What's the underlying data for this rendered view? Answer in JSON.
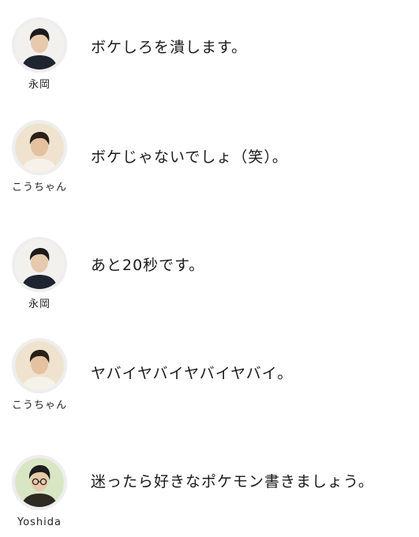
{
  "messages": [
    {
      "speaker": "永岡",
      "avatar": "person-dark-hair-icon",
      "text": "ボケしろを潰します。"
    },
    {
      "speaker": "こうちゃん",
      "avatar": "person-light-background-icon",
      "text": "ボケじゃないでしょ（笑）。"
    },
    {
      "speaker": "永岡",
      "avatar": "person-dark-hair-icon",
      "text": "あと20秒です。"
    },
    {
      "speaker": "こうちゃん",
      "avatar": "person-light-background-icon",
      "text": "ヤバイヤバイヤバイヤバイ。"
    },
    {
      "speaker": "Yoshida",
      "avatar": "person-glasses-icon",
      "text": "迷ったら好きなポケモン書きましょう。"
    }
  ],
  "colors": {
    "background": "#ffffff",
    "text": "#1a1a1a",
    "avatar_ring": "#eeeeee"
  }
}
